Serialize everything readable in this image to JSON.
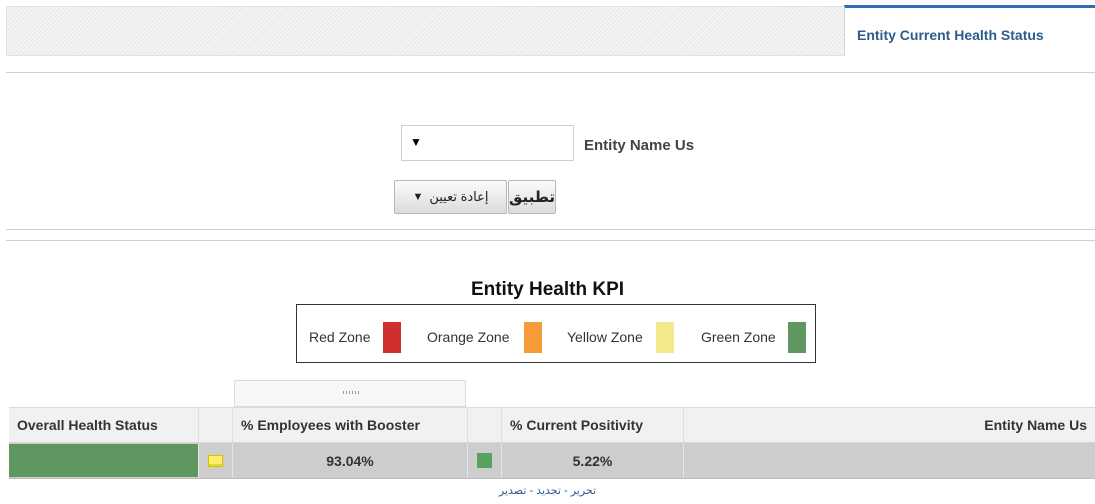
{
  "header": {
    "active_tab": "Entity Current Health Status"
  },
  "prompt": {
    "entity_label": "Entity Name Us",
    "entity_value": "",
    "reset_label": "إعادة تعيين",
    "apply_label": "تطبيق"
  },
  "kpi": {
    "title": "Entity Health KPI",
    "legend": [
      {
        "label": "Red Zone",
        "color": "#d12f2f"
      },
      {
        "label": "Orange Zone",
        "color": "#f79a38"
      },
      {
        "label": "Yellow Zone",
        "color": "#f4e88c"
      },
      {
        "label": "Green Zone",
        "color": "#5f9760"
      }
    ]
  },
  "table": {
    "headers": {
      "overall": "Overall Health Status",
      "booster": "% Employees with Booster",
      "positivity": "% Current Positivity",
      "entity": "Entity Name Us"
    },
    "row": {
      "overall_color": "#5f9760",
      "booster_indicator": "yellow-square-icon",
      "booster_value": "93.04%",
      "positivity_indicator": "green-square-icon",
      "positivity_color": "#57a25e",
      "positivity_value": "5.22%",
      "entity": ""
    }
  },
  "footer": {
    "links": [
      "تحرير",
      "تجديد",
      "تصدير"
    ],
    "separator": " - "
  }
}
